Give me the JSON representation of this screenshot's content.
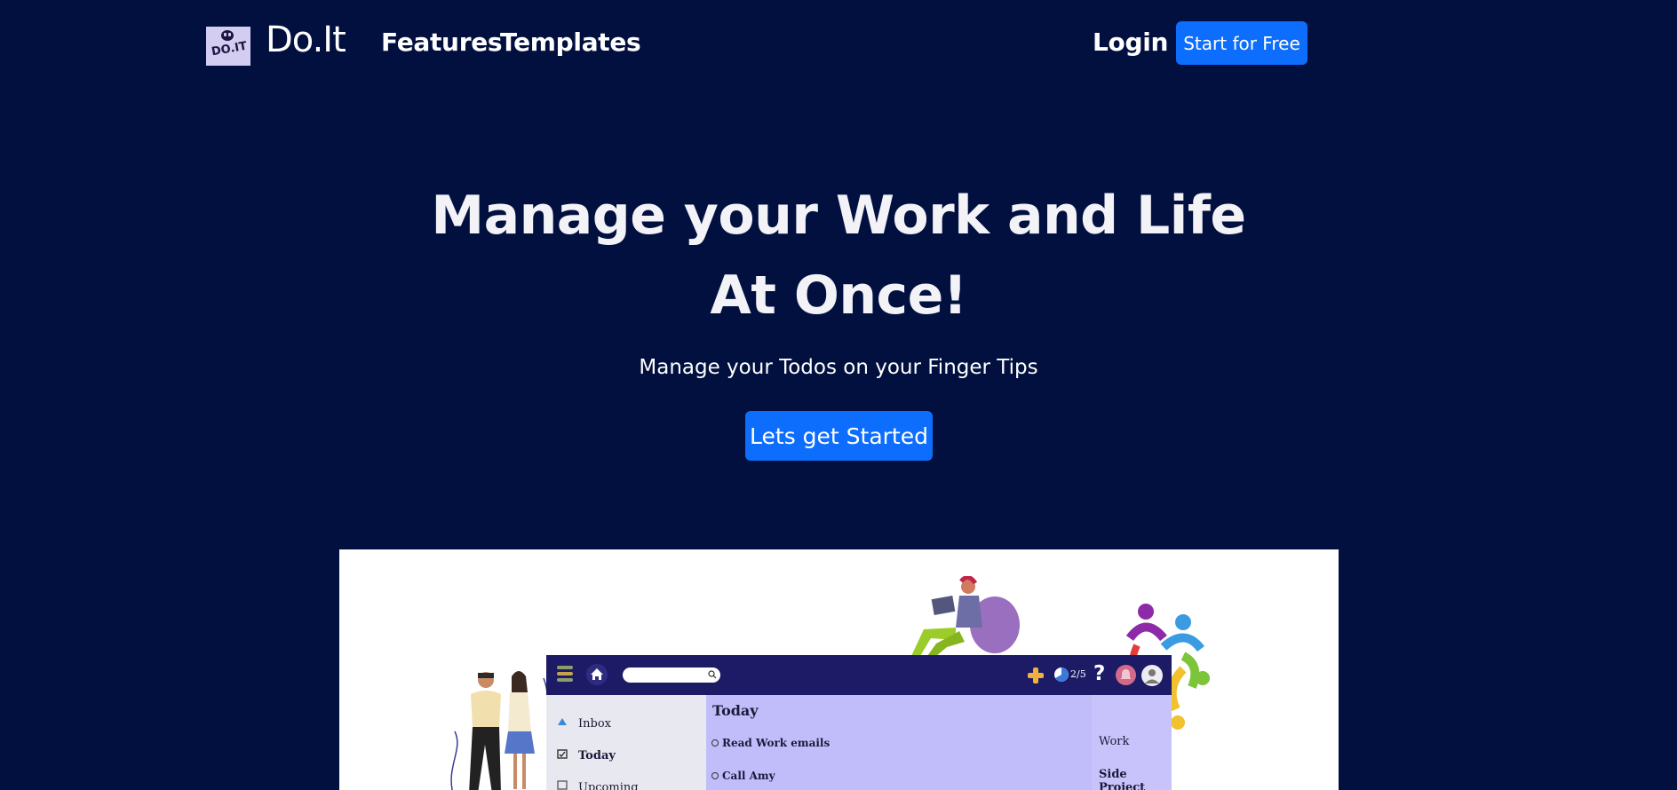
{
  "nav": {
    "logo_text": "DO.IT",
    "brand": "Do.It",
    "links": [
      "Features",
      "Templates"
    ],
    "login": "Login",
    "cta": "Start for Free"
  },
  "hero": {
    "title_line1": "Manage your Work and Life",
    "title_line2": "At Once!",
    "subtitle": "Manage your Todos on your Finger Tips",
    "cta": "Lets get Started"
  },
  "mockup": {
    "karma": "2/5",
    "help": "?",
    "sidebar": [
      "Inbox",
      "Today",
      "Upcoming"
    ],
    "main_title": "Today",
    "tasks": [
      "Read Work emails",
      "Call Amy"
    ],
    "projects": [
      "Work",
      "Side Project"
    ]
  },
  "colors": {
    "background": "#01103f",
    "accent": "#0d6efd",
    "app_bar": "#1d1b66",
    "main_panel": "#c1bdfa"
  }
}
